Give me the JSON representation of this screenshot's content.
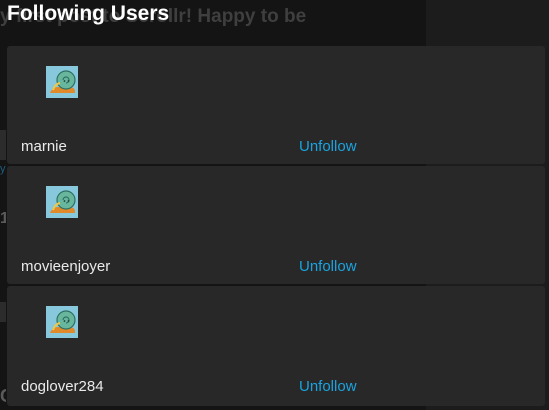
{
  "background": {
    "post_text": "y first post to Scrollr! Happy to be"
  },
  "modal": {
    "title": "Following Users",
    "users": [
      {
        "username": "marnie",
        "action": "Unfollow",
        "avatar_icon": "snail-avatar-icon"
      },
      {
        "username": "movieenjoyer",
        "action": "Unfollow",
        "avatar_icon": "snail-avatar-icon"
      },
      {
        "username": "doglover284",
        "action": "Unfollow",
        "avatar_icon": "snail-avatar-icon"
      }
    ]
  },
  "colors": {
    "background": "#1f1f1f",
    "card": "#282828",
    "link": "#1aa3e0",
    "text": "#eaeaea",
    "avatar_bg": "#87c8dc"
  }
}
